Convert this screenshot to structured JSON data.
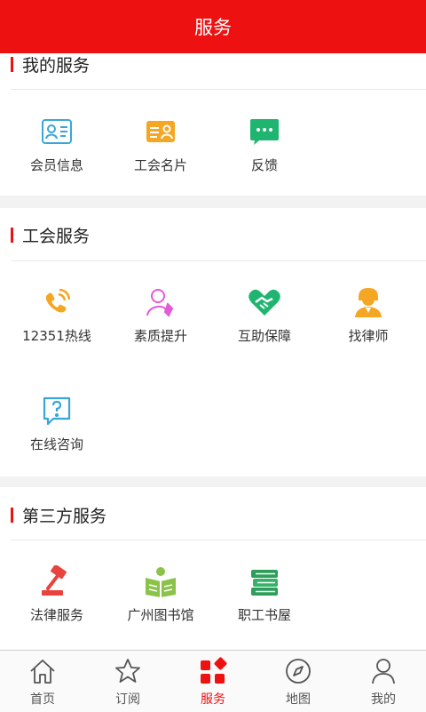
{
  "header": {
    "title": "服务"
  },
  "my_services": {
    "title": "我的服务",
    "items": [
      {
        "label": "会员信息",
        "icon": "member-card-icon"
      },
      {
        "label": "工会名片",
        "icon": "business-card-icon"
      },
      {
        "label": "反馈",
        "icon": "feedback-chat-icon"
      }
    ]
  },
  "union_services": {
    "title": "工会服务",
    "items": [
      {
        "label": "12351热线",
        "icon": "phone-hotline-icon"
      },
      {
        "label": "素质提升",
        "icon": "person-rocket-icon"
      },
      {
        "label": "互助保障",
        "icon": "handshake-heart-icon"
      },
      {
        "label": "找律师",
        "icon": "lawyer-icon"
      },
      {
        "label": "在线咨询",
        "icon": "question-chat-icon"
      }
    ]
  },
  "third_party": {
    "title": "第三方服务",
    "items": [
      {
        "label": "法律服务",
        "icon": "gavel-icon"
      },
      {
        "label": "广州图书馆",
        "icon": "reader-book-icon"
      },
      {
        "label": "职工书屋",
        "icon": "books-stack-icon"
      }
    ]
  },
  "tabbar": {
    "items": [
      {
        "label": "首页",
        "icon": "home-icon"
      },
      {
        "label": "订阅",
        "icon": "star-icon"
      },
      {
        "label": "服务",
        "icon": "grid-service-icon",
        "active": true
      },
      {
        "label": "地图",
        "icon": "compass-icon"
      },
      {
        "label": "我的",
        "icon": "user-icon"
      }
    ]
  },
  "colors": {
    "accent": "#ee1111",
    "icon_blue": "#3aa6d8",
    "icon_orange": "#f5a623",
    "icon_green": "#1fb570",
    "icon_pink": "#e45bd6"
  }
}
